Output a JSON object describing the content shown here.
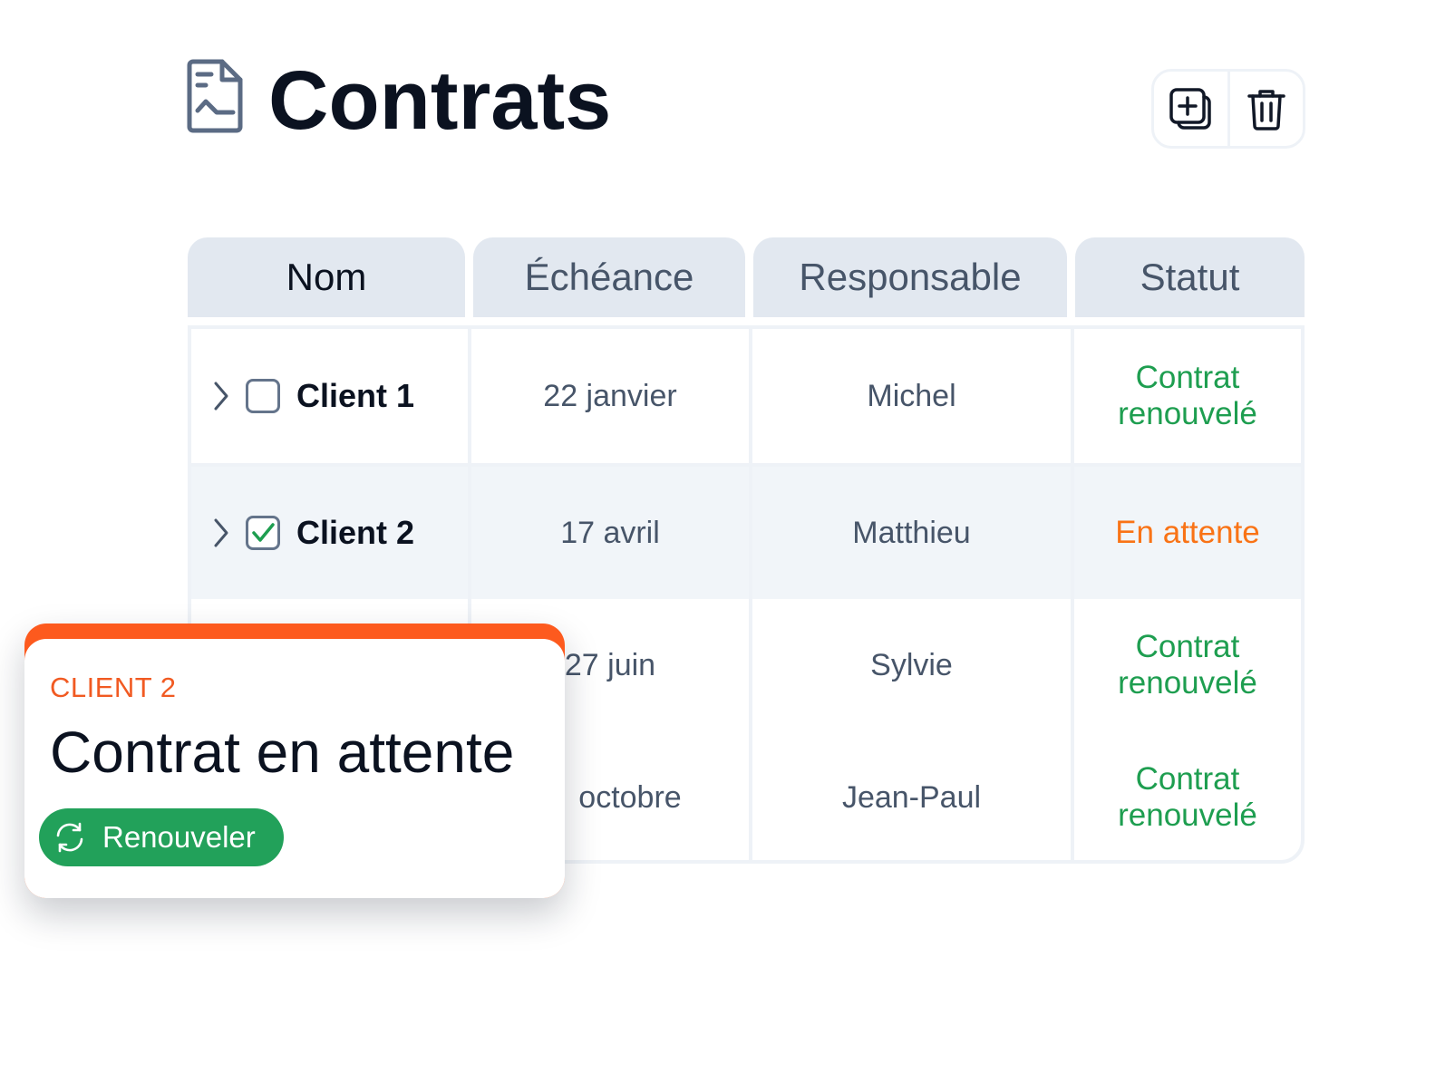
{
  "header": {
    "title": "Contrats",
    "icon": "document-chart-icon"
  },
  "toolbar": {
    "add_icon": "add-copy-icon",
    "delete_icon": "trash-icon"
  },
  "table": {
    "columns": [
      "Nom",
      "Échéance",
      "Responsable",
      "Statut"
    ],
    "rows": [
      {
        "name": "Client 1",
        "checked": false,
        "date": "22 janvier",
        "owner": "Michel",
        "status": "Contrat renouvelé",
        "status_line1": "Contrat",
        "status_line2": "renouvelé",
        "status_color": "#1e9e50"
      },
      {
        "name": "Client 2",
        "checked": true,
        "date": "17 avril",
        "owner": "Matthieu",
        "status": "En attente",
        "status_line1": "En attente",
        "status_line2": "",
        "status_color": "#f97316"
      },
      {
        "name": "",
        "checked": false,
        "date": "27 juin",
        "owner": "Sylvie",
        "status": "Contrat renouvelé",
        "status_line1": "Contrat",
        "status_line2": "renouvelé",
        "status_color": "#1e9e50"
      },
      {
        "name": "",
        "checked": false,
        "date": "octobre",
        "owner": "Jean-Paul",
        "status": "Contrat renouvelé",
        "status_line1": "Contrat",
        "status_line2": "renouvelé",
        "status_color": "#1e9e50"
      }
    ]
  },
  "popup": {
    "label": "CLIENT 2",
    "title": "Contrat en attente",
    "button_label": "Renouveler",
    "accent_color": "#fd5a1e",
    "button_color": "#22a15a"
  }
}
